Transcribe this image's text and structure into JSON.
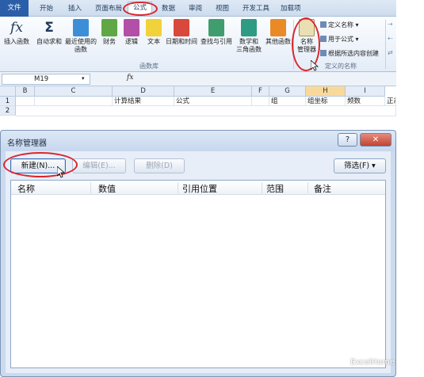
{
  "ribbon": {
    "tabs": [
      "文件",
      "开始",
      "插入",
      "页面布局",
      "公式",
      "数据",
      "审阅",
      "视图",
      "开发工具",
      "加载项"
    ],
    "function_library": {
      "buttons": [
        {
          "label": "插入函数",
          "icon": "fx-icon"
        },
        {
          "label": "自动求和",
          "icon": "sigma-icon"
        },
        {
          "label": "最近使用的\n函数",
          "icon": "recent-book-icon"
        },
        {
          "label": "财务",
          "icon": "finance-book-icon"
        },
        {
          "label": "逻辑",
          "icon": "logic-book-icon"
        },
        {
          "label": "文本",
          "icon": "text-book-icon"
        },
        {
          "label": "日期和时间",
          "icon": "date-book-icon"
        },
        {
          "label": "查找与引用",
          "icon": "lookup-book-icon"
        },
        {
          "label": "数学和\n三角函数",
          "icon": "math-book-icon"
        },
        {
          "label": "其他函数",
          "icon": "other-book-icon"
        }
      ],
      "group_label": "函数库"
    },
    "defined_names": {
      "name_manager_label": "名称\n管理器",
      "define_name": "定义名称",
      "use_in_formula": "用于公式",
      "create_from_selection": "根据所选内容创建",
      "group_label": "定义的名称"
    },
    "far_right_icons": [
      "trace-precedents-icon",
      "trace-dependents-icon",
      "remove-arrows-icon"
    ]
  },
  "formula_bar": {
    "name_box": "M19",
    "fx_label": "fx",
    "formula": ""
  },
  "sheet": {
    "columns": [
      "B",
      "C",
      "D",
      "E",
      "F",
      "G",
      "H",
      "I"
    ],
    "rows": [
      {
        "num": "1",
        "cells": [
          "",
          "",
          "计算结果",
          "公式",
          "",
          "组",
          "组坐标",
          "频数",
          "正态"
        ]
      },
      {
        "num": "2",
        "cells": [
          "",
          "",
          "",
          "",
          "",
          "",
          "",
          "",
          ""
        ]
      }
    ]
  },
  "dialog": {
    "title": "名称管理器",
    "help_label": "?",
    "close_label": "✕",
    "new_button": "新建(N)...",
    "edit_button": "编辑(E)...",
    "delete_button": "删除(D)",
    "filter_button": "筛选(F) ▾",
    "columns": [
      "名称",
      "数值",
      "引用位置",
      "范围",
      "备注"
    ]
  },
  "watermark": "ExcelHome",
  "colors": {
    "highlight_ring": "#d9262c",
    "file_tab": "#2a5ea8",
    "close_button": "#c2432f"
  }
}
